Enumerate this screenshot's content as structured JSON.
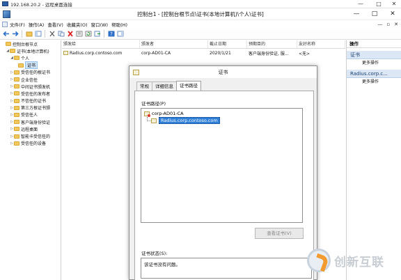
{
  "rdp": {
    "title": "192.168.20.2 - 远程桌面连接",
    "minimize": "—",
    "restore": "□",
    "close": "✕"
  },
  "window": {
    "title": "控制台1 - [控制台根节点\\证书(本地计算机)\\个人\\证书]",
    "minimize": "—",
    "maximize": "□",
    "close": "✕"
  },
  "menu": {
    "items": [
      "文件(F)",
      "操作(A)",
      "查看(V)",
      "收藏夹(O)",
      "窗口(W)",
      "帮助(H)"
    ],
    "mdi": [
      "—",
      "▫",
      "✕"
    ]
  },
  "tree": {
    "items": [
      {
        "label": "控制台根节点",
        "level": 0,
        "arrow": ""
      },
      {
        "label": "证书(本地计算机)",
        "level": 1,
        "arrow": "◢"
      },
      {
        "label": "个人",
        "level": 2,
        "arrow": "◢"
      },
      {
        "label": "证书",
        "level": 3,
        "arrow": "",
        "selected": true
      },
      {
        "label": "受信任的根证书",
        "level": 2,
        "arrow": "▷"
      },
      {
        "label": "企业信任",
        "level": 2,
        "arrow": "▷"
      },
      {
        "label": "中间证书颁发机",
        "level": 2,
        "arrow": "▷"
      },
      {
        "label": "受信任的发布者",
        "level": 2,
        "arrow": "▷"
      },
      {
        "label": "不信任的证书",
        "level": 2,
        "arrow": "▷"
      },
      {
        "label": "第三方根证书颁",
        "level": 2,
        "arrow": "▷"
      },
      {
        "label": "受信任人",
        "level": 2,
        "arrow": "▷"
      },
      {
        "label": "客户端身份验证",
        "level": 2,
        "arrow": "▷"
      },
      {
        "label": "远程桌面",
        "level": 2,
        "arrow": "▷"
      },
      {
        "label": "智能卡受信任的",
        "level": 2,
        "arrow": "▷"
      },
      {
        "label": "受信任的设备",
        "level": 2,
        "arrow": "▷"
      }
    ]
  },
  "list": {
    "columns": [
      "颁发给",
      "颁发者",
      "截止日期",
      "预期目的",
      "友好名称"
    ],
    "rows": [
      [
        "Radius.corp.contoso.com",
        "corp-AD01-CA",
        "2020/1/21",
        "客户端身份验证, 服...",
        "<无>"
      ]
    ]
  },
  "actions": {
    "header": "操作",
    "section1": "证书",
    "link1": "更多操作",
    "section2": "Radius.corp.c...",
    "link2": "更多操作"
  },
  "dialog": {
    "title": "证书",
    "tabs": [
      "常规",
      "详细信息",
      "证书路径"
    ],
    "active_tab": 2,
    "path_label": "证书路径(P)",
    "path": [
      "corp-AD01-CA",
      "Radius.corp.contoso.com"
    ],
    "view_button": "查看证书(V)",
    "status_label": "证书状态(S):",
    "status_text": "该证书没有问题。"
  },
  "watermark": {
    "text": "创新互联"
  }
}
